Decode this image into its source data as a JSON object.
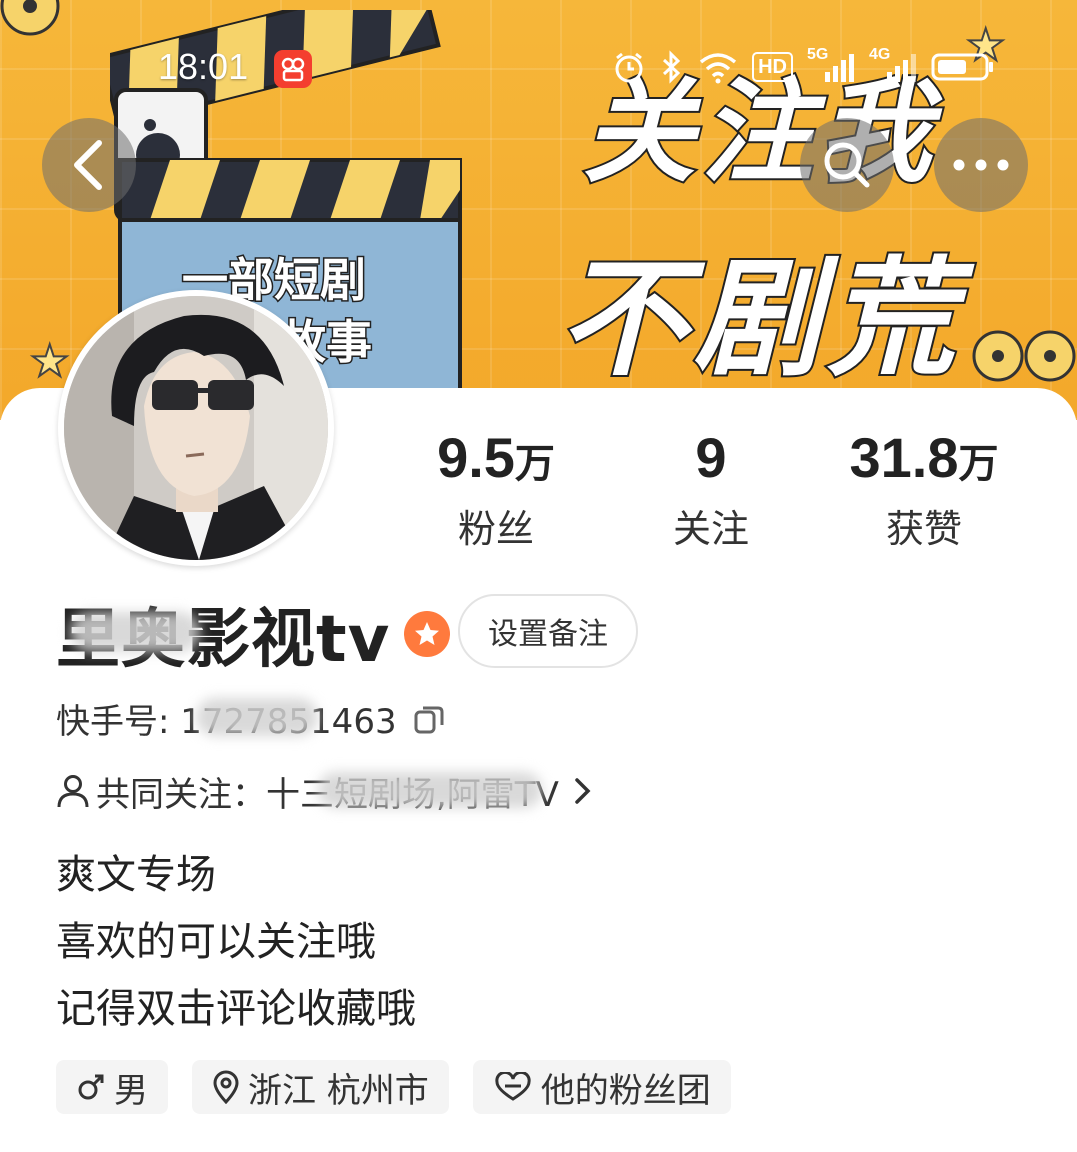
{
  "status_bar": {
    "time": "18:01",
    "icons": [
      "alarm-icon",
      "bluetooth-icon",
      "wifi-icon",
      "hd-icon",
      "5g-signal-icon",
      "4g-signal-icon",
      "battery-icon"
    ],
    "hd_label": "HD",
    "net_5g": "5G",
    "net_4g": "4G"
  },
  "banner": {
    "slogan_line1": "关注我",
    "slogan_line2": "不剧荒",
    "clapper_line1": "一部短剧",
    "clapper_line2": "故事"
  },
  "nav": {
    "back_icon": "chevron-left-icon",
    "search_icon": "search-icon",
    "more_icon": "more-horizontal-icon"
  },
  "stats": [
    {
      "value": "9.5",
      "unit": "万",
      "label": "粉丝"
    },
    {
      "value": "9",
      "unit": "",
      "label": "关注"
    },
    {
      "value": "31.8",
      "unit": "万",
      "label": "获赞"
    }
  ],
  "profile": {
    "display_name": "里奥影视tv",
    "remark_button": "设置备注",
    "kuaishou_id": "快手号: 1727851463",
    "mutual_follow": "共同关注：十三短剧场,阿雷TV",
    "bio": [
      "爽文专场",
      "喜欢的可以关注哦",
      "记得双击评论收藏哦"
    ],
    "tags": [
      {
        "icon": "male-icon",
        "label": "男"
      },
      {
        "icon": "location-icon",
        "label": "浙江 杭州市"
      },
      {
        "icon": "heart-badge-icon",
        "label": "他的粉丝团"
      }
    ]
  },
  "colors": {
    "banner_yellow": "#f3a82a",
    "verified_orange": "#ff7a3d",
    "tag_bg": "#f4f4f4",
    "text_primary": "#222222"
  }
}
